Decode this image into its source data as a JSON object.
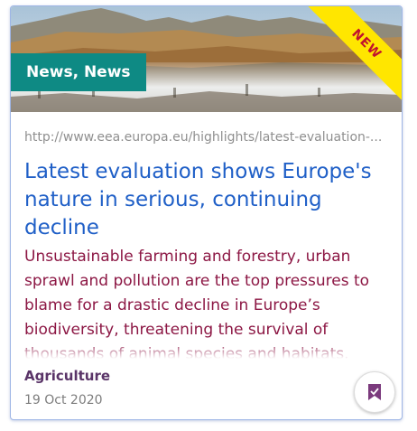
{
  "card": {
    "badge": "News, News",
    "ribbon": "NEW",
    "url": "http://www.eea.europa.eu/highlights/latest-evaluation-...",
    "title": "Latest evaluation shows Europe's nature in serious, continuing decline",
    "summary": "Unsustainable farming and forestry, urban sprawl and pollution are the top pressures to blame for a drastic decline in Europe’s biodiversity, threatening the survival of thousands of animal species and habitats.",
    "category": "Agriculture",
    "date": "19 Oct 2020",
    "bookmark_icon": "bookmark-icon"
  },
  "colors": {
    "badge_bg": "#0e8a84",
    "ribbon_bg": "#ffe600",
    "ribbon_text": "#c0122e",
    "title": "#1f5fc7",
    "summary": "#8c1744",
    "category": "#5a3468",
    "bookmark_icon": "#7b3a7d"
  }
}
